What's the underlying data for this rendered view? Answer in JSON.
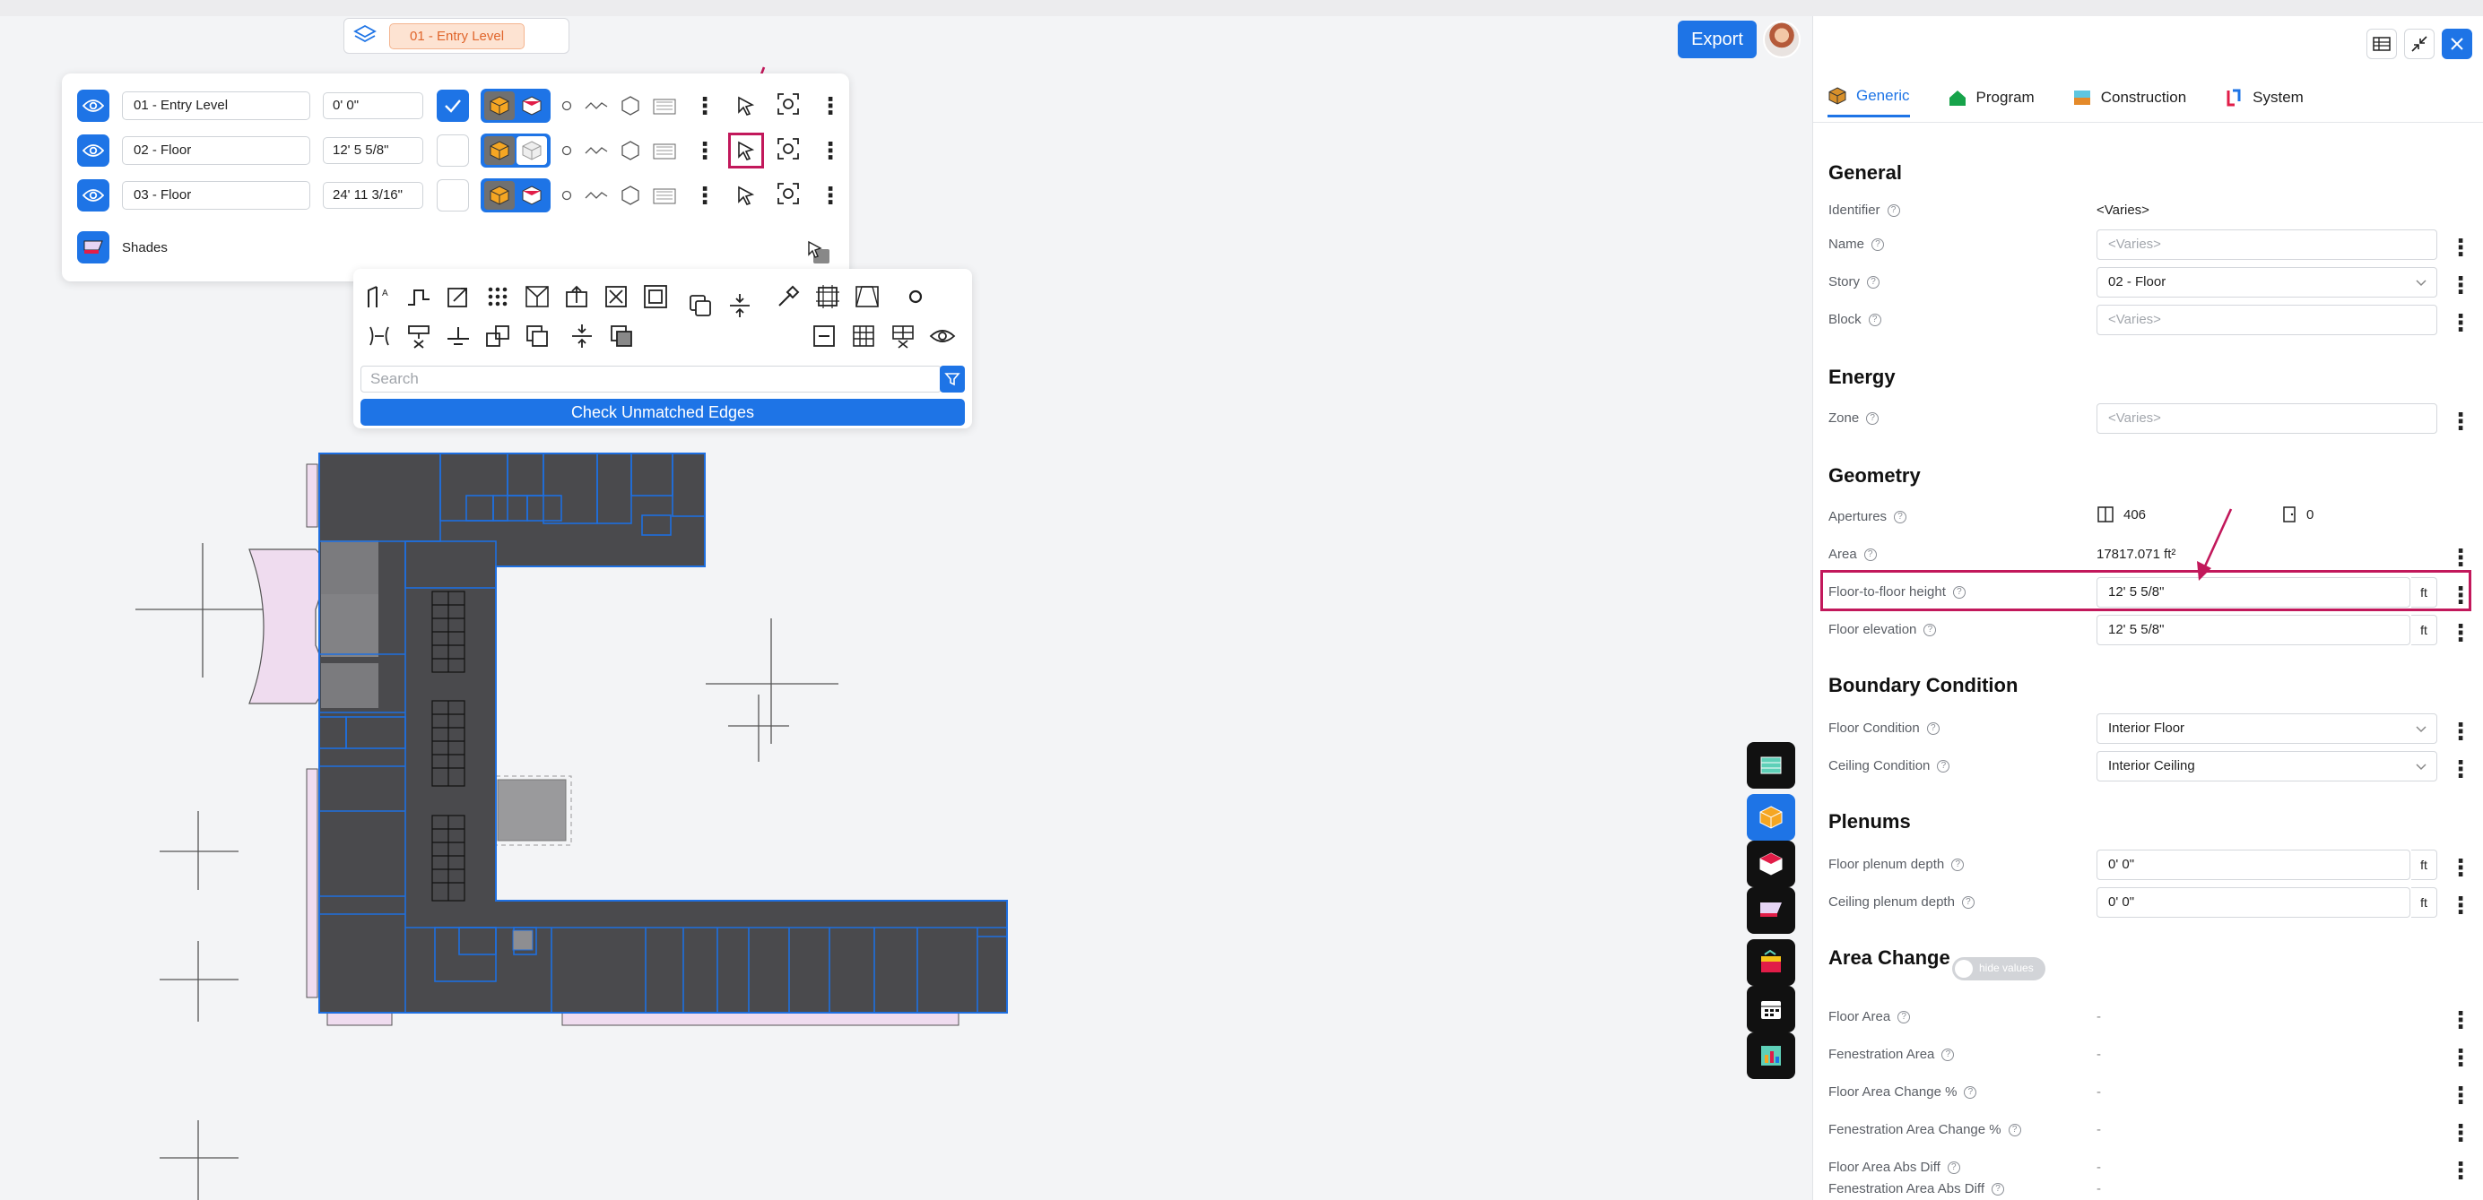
{
  "top_badge": {
    "level": "01 - Entry Level"
  },
  "levels": [
    {
      "name": "01 - Entry Level",
      "elevation": "0' 0\"",
      "checked": true,
      "highlight": false
    },
    {
      "name": "02 - Floor",
      "elevation": "12' 5 5/8\"",
      "checked": false,
      "highlight": true
    },
    {
      "name": "03 - Floor",
      "elevation": "24' 11 3/16\"",
      "checked": false,
      "highlight": false
    }
  ],
  "shades": {
    "label": "Shades"
  },
  "tools": {
    "search_placeholder": "Search",
    "check_button": "Check Unmatched Edges"
  },
  "header": {
    "export_label": "Export"
  },
  "panel": {
    "tabs": [
      {
        "label": "Generic",
        "icon": "cube-icon",
        "color": "#d8902a"
      },
      {
        "label": "Program",
        "icon": "house-icon",
        "color": "#16a34a"
      },
      {
        "label": "Construction",
        "icon": "wall-icon",
        "color": "#e48a2a"
      },
      {
        "label": "System",
        "icon": "duct-icon",
        "color": "#e11d48"
      }
    ],
    "general": {
      "title": "General",
      "identifier_label": "Identifier",
      "identifier_value": "<Varies>",
      "name_label": "Name",
      "name_placeholder": "<Varies>",
      "story_label": "Story",
      "story_value": "02 - Floor",
      "block_label": "Block",
      "block_placeholder": "<Varies>"
    },
    "energy": {
      "title": "Energy",
      "zone_label": "Zone",
      "zone_placeholder": "<Varies>"
    },
    "geometry": {
      "title": "Geometry",
      "apertures_label": "Apertures",
      "windows_count": "406",
      "doors_count": "0",
      "area_label": "Area",
      "area_value": "17817.071 ft²",
      "f2f_label": "Floor-to-floor height",
      "f2f_value": "12' 5 5/8\"",
      "elev_label": "Floor elevation",
      "elev_value": "12' 5 5/8\"",
      "unit": "ft"
    },
    "boundary": {
      "title": "Boundary Condition",
      "floor_label": "Floor Condition",
      "floor_value": "Interior Floor",
      "ceiling_label": "Ceiling Condition",
      "ceiling_value": "Interior Ceiling"
    },
    "plenums": {
      "title": "Plenums",
      "floor_label": "Floor plenum depth",
      "floor_value": "0' 0\"",
      "ceiling_label": "Ceiling plenum depth",
      "ceiling_value": "0' 0\"",
      "unit": "ft"
    },
    "area_change": {
      "title": "Area Change",
      "toggle_label": "hide values",
      "rows": [
        {
          "label": "Floor Area",
          "value": "-"
        },
        {
          "label": "Fenestration Area",
          "value": "-"
        },
        {
          "label": "Floor Area Change %",
          "value": "-"
        },
        {
          "label": "Fenestration Area Change %",
          "value": "-"
        },
        {
          "label": "Floor Area Abs Diff",
          "value": "-"
        },
        {
          "label": "Fenestration Area Abs Diff",
          "value": "-"
        }
      ]
    }
  },
  "colors": {
    "accent": "#1e74e6",
    "highlight": "#c2185b",
    "floor_fill": "#4a4a4d",
    "outline": "#1e6fe0"
  }
}
